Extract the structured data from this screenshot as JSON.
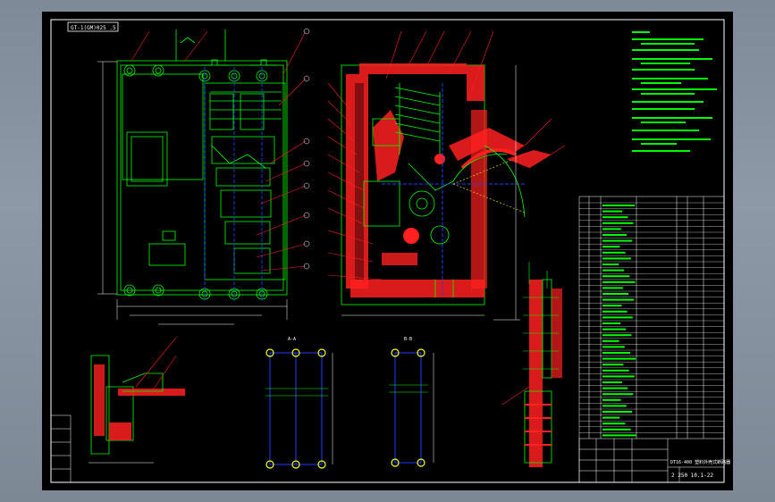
{
  "drawing": {
    "title_tab": "GT-1(GM)025 .5",
    "title_block": {
      "name_line": "DT16-400 塑料外壳式断路器",
      "drawing_number": "2 250 10.1-22"
    },
    "section_label_a": "A-A",
    "section_label_b": "B-B",
    "colors": {
      "background": "#000000",
      "frame": "#ffffff",
      "outline": "#00ff00",
      "hatch": "#ff3030",
      "dimension": "#ffffff",
      "centerline": "#2040ff",
      "leader": "#ff2020",
      "annotation": "#ffff00"
    }
  }
}
